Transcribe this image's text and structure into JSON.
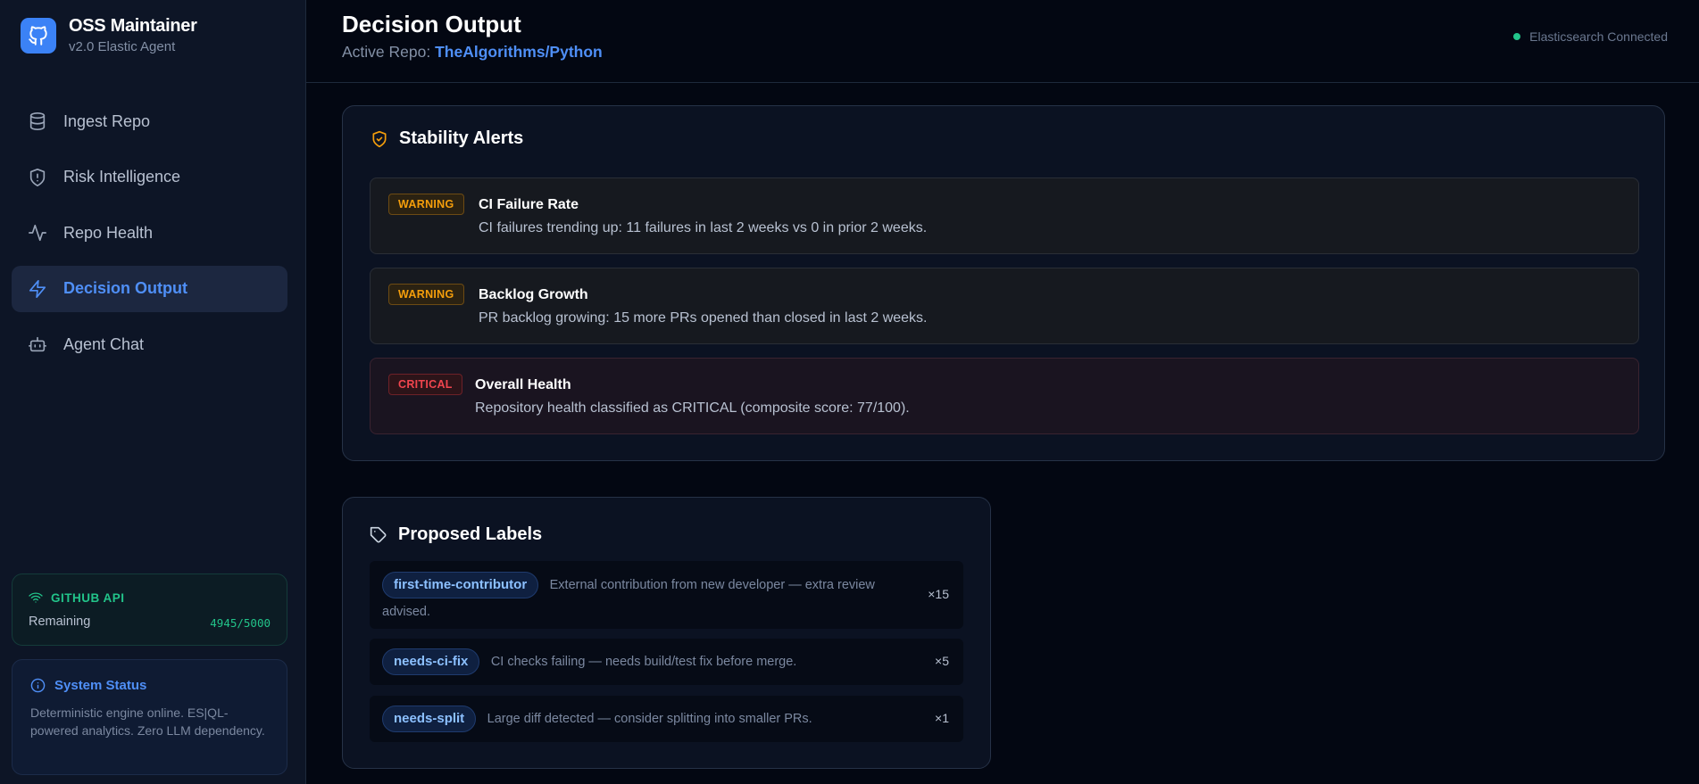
{
  "app": {
    "title": "OSS Maintainer",
    "subtitle": "v2.0 Elastic Agent"
  },
  "nav": {
    "items": [
      {
        "label": "Ingest Repo",
        "icon": "database-icon",
        "active": false
      },
      {
        "label": "Risk Intelligence",
        "icon": "shield-alert-icon",
        "active": false
      },
      {
        "label": "Repo Health",
        "icon": "activity-icon",
        "active": false
      },
      {
        "label": "Decision Output",
        "icon": "lightning-icon",
        "active": true
      },
      {
        "label": "Agent Chat",
        "icon": "bot-icon",
        "active": false
      }
    ]
  },
  "github_api": {
    "title": "GITHUB API",
    "remaining_label": "Remaining",
    "remaining_value": "4945/5000"
  },
  "system_status": {
    "title": "System Status",
    "body": "Deterministic engine online. ES|QL-powered analytics. Zero LLM dependency."
  },
  "header": {
    "title": "Decision Output",
    "active_repo_label": "Active Repo:",
    "active_repo": "TheAlgorithms/Python",
    "connection_status": "Elasticsearch Connected"
  },
  "stability_alerts": {
    "title": "Stability Alerts",
    "alerts": [
      {
        "severity": "WARNING",
        "title": "CI Failure Rate",
        "description": "CI failures trending up: 11 failures in last 2 weeks vs 0 in prior 2 weeks."
      },
      {
        "severity": "WARNING",
        "title": "Backlog Growth",
        "description": "PR backlog growing: 15 more PRs opened than closed in last 2 weeks."
      },
      {
        "severity": "CRITICAL",
        "title": "Overall Health",
        "description": "Repository health classified as CRITICAL (composite score: 77/100)."
      }
    ]
  },
  "proposed_labels": {
    "title": "Proposed Labels",
    "labels": [
      {
        "name": "first-time-contributor",
        "description": "External contribution from new developer — extra review advised.",
        "count": "×15"
      },
      {
        "name": "needs-ci-fix",
        "description": "CI checks failing — needs build/test fix before merge.",
        "count": "×5"
      },
      {
        "name": "needs-split",
        "description": "Large diff detected — consider splitting into smaller PRs.",
        "count": "×1"
      }
    ]
  },
  "colors": {
    "accent": "#3b82f6",
    "success": "#22c48a",
    "warning": "#f59e0b",
    "critical": "#f0454e",
    "background": "#030712"
  }
}
